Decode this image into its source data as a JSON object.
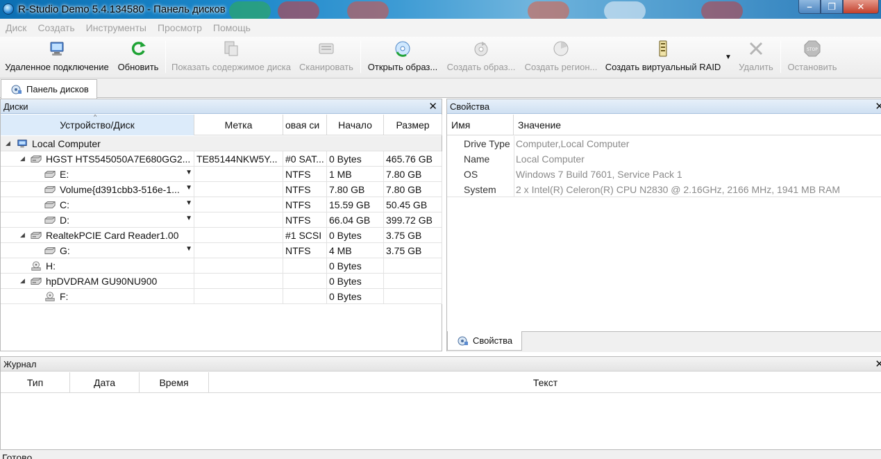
{
  "window": {
    "title": "R-Studio Demo 5.4.134580 - Панель дисков",
    "minimize": "–",
    "maximize": "❐",
    "close": "✕"
  },
  "menu": [
    "Диск",
    "Создать",
    "Инструменты",
    "Просмотр",
    "Помощь"
  ],
  "toolbar": [
    {
      "label": "Удаленное подключение",
      "icon": "remote-computer-icon",
      "enabled": true
    },
    {
      "label": "Обновить",
      "icon": "refresh-icon",
      "enabled": true
    },
    {
      "label": "Показать содержимое диска",
      "icon": "show-contents-icon",
      "enabled": false
    },
    {
      "label": "Сканировать",
      "icon": "scan-icon",
      "enabled": false
    },
    {
      "label": "Открыть образ...",
      "icon": "open-image-icon",
      "enabled": true
    },
    {
      "label": "Создать образ...",
      "icon": "create-image-icon",
      "enabled": false
    },
    {
      "label": "Создать регион...",
      "icon": "create-region-icon",
      "enabled": false
    },
    {
      "label": "Создать виртуальный RAID",
      "icon": "virtual-raid-icon",
      "enabled": true
    },
    {
      "label": "Удалить",
      "icon": "delete-icon",
      "enabled": false
    },
    {
      "label": "Остановить",
      "icon": "stop-icon",
      "enabled": false
    }
  ],
  "tabs": {
    "main": "Панель дисков",
    "properties": "Свойства"
  },
  "disks_panel": {
    "title": "Диски",
    "close": "✕",
    "columns": [
      "Устройство/Диск",
      "Метка",
      "овая си",
      "Начало",
      "Размер"
    ],
    "rows": [
      {
        "type": "group",
        "name": "Local Computer",
        "icon": "computer-icon"
      },
      {
        "type": "drive",
        "name": "HGST HTS545050A7E680GG2...",
        "label": "TE85144NKW5Y...",
        "fs": "#0 SAT...",
        "start": "0 Bytes",
        "size": "465.76 GB",
        "icon": "hard-drive-icon"
      },
      {
        "type": "partition",
        "name": "E:",
        "label": "",
        "fs": "NTFS",
        "start": "1 MB",
        "size": "7.80 GB",
        "icon": "partition-icon"
      },
      {
        "type": "partition",
        "name": "Volume{d391cbb3-516e-1...",
        "label": "",
        "fs": "NTFS",
        "start": "7.80 GB",
        "size": "7.80 GB",
        "icon": "partition-icon"
      },
      {
        "type": "partition",
        "name": "C:",
        "label": "",
        "fs": "NTFS",
        "start": "15.59 GB",
        "size": "50.45 GB",
        "icon": "partition-icon"
      },
      {
        "type": "partition",
        "name": "D:",
        "label": "",
        "fs": "NTFS",
        "start": "66.04 GB",
        "size": "399.72 GB",
        "icon": "partition-icon"
      },
      {
        "type": "drive",
        "name": "RealtekPCIE Card Reader1.00",
        "label": "",
        "fs": "#1 SCSI",
        "start": "0 Bytes",
        "size": "3.75 GB",
        "icon": "hard-drive-icon"
      },
      {
        "type": "partition",
        "name": "G:",
        "label": "",
        "fs": "NTFS",
        "start": "4 MB",
        "size": "3.75 GB",
        "icon": "partition-icon"
      },
      {
        "type": "cdrom",
        "name": "H:",
        "label": "",
        "fs": "",
        "start": "0 Bytes",
        "size": "",
        "icon": "optical-drive-icon"
      },
      {
        "type": "drive",
        "name": "hpDVDRAM GU90NU900",
        "label": "",
        "fs": "",
        "start": "0 Bytes",
        "size": "",
        "icon": "hard-drive-icon"
      },
      {
        "type": "cdrom-child",
        "name": "F:",
        "label": "",
        "fs": "",
        "start": "0 Bytes",
        "size": "",
        "icon": "optical-drive-icon"
      }
    ]
  },
  "properties_panel": {
    "title": "Свойства",
    "close": "✕",
    "columns": [
      "Имя",
      "Значение"
    ],
    "rows": [
      {
        "key": "Drive Type",
        "value": "Computer,Local Computer"
      },
      {
        "key": "Name",
        "value": "Local Computer"
      },
      {
        "key": "OS",
        "value": "Windows 7 Build 7601, Service Pack 1"
      },
      {
        "key": "System",
        "value": "2 x Intel(R) Celeron(R) CPU  N2830  @ 2.16GHz, 2166 MHz, 1941 MB RAM"
      }
    ]
  },
  "journal_panel": {
    "title": "Журнал",
    "close": "✕",
    "columns": [
      "Тип",
      "Дата",
      "Время",
      "Текст"
    ]
  },
  "status": "Готово"
}
